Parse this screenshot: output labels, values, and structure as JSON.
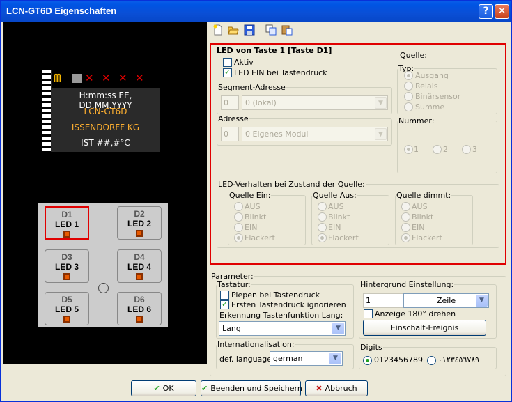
{
  "window": {
    "title": "LCN-GT6D Eigenschaften"
  },
  "toolbar": {
    "icons": [
      "new-icon",
      "open-icon",
      "save-icon",
      "copy-icon",
      "paste-icon"
    ]
  },
  "display": {
    "line1": "H:mm:ss EE, DD.MM.YYYY",
    "line2": "LCN-GT6D",
    "line3": "ISSENDORFF KG",
    "line4": "IST ##,#°C",
    "line_colors": [
      "#ffffff",
      "#ffb030",
      "#ffb030",
      "#ffffff"
    ]
  },
  "keys": [
    {
      "top": "D1",
      "bottom": "LED 1",
      "selected": true
    },
    {
      "top": "D2",
      "bottom": "LED 2",
      "selected": false
    },
    {
      "top": "D3",
      "bottom": "LED 3",
      "selected": false
    },
    {
      "top": "D4",
      "bottom": "LED 4",
      "selected": false
    },
    {
      "top": "D5",
      "bottom": "LED 5",
      "selected": false
    },
    {
      "top": "D6",
      "bottom": "LED 6",
      "selected": false
    }
  ],
  "led": {
    "group_title": "LED von Taste 1 [Taste D1]",
    "aktiv_label": "Aktiv",
    "aktiv_checked": false,
    "led_ein_label": "LED EIN bei Tastendruck",
    "led_ein_checked": true,
    "segment": {
      "legend": "Segment-Adresse",
      "value": "0",
      "option": "0 (lokal)"
    },
    "adresse": {
      "legend": "Adresse",
      "value": "0",
      "option": "0  Eigenes Modul"
    },
    "quelle": {
      "legend": "Quelle:",
      "typ_legend": "Typ:",
      "typ_options": [
        "Ausgang",
        "Relais",
        "Binärsensor",
        "Summe"
      ],
      "nummer_legend": "Nummer:",
      "nummer_options": [
        "1",
        "2",
        "3"
      ]
    },
    "verhalten": {
      "legend": "LED-Verhalten bei Zustand der Quelle:",
      "groups": [
        {
          "legend": "Quelle Ein:",
          "options": [
            "AUS",
            "Blinkt",
            "EIN",
            "Flackert"
          ]
        },
        {
          "legend": "Quelle Aus:",
          "options": [
            "AUS",
            "Blinkt",
            "EIN",
            "Flackert"
          ]
        },
        {
          "legend": "Quelle dimmt:",
          "options": [
            "AUS",
            "Blinkt",
            "EIN",
            "Flackert"
          ]
        }
      ]
    }
  },
  "parameter": {
    "legend": "Parameter:",
    "tastatur": {
      "legend": "Tastatur:",
      "piepen_label": "Piepen bei Tastendruck",
      "piepen_checked": false,
      "ersten_label": "Ersten Tastendruck ignorieren",
      "ersten_checked": true,
      "erkennung_label": "Erkennung Tastenfunktion Lang:",
      "erkennung_value": "Lang"
    },
    "hintergrund": {
      "legend": "Hintergrund Einstellung:",
      "count": "1",
      "unit": "Zeile",
      "anzeige_label": "Anzeige 180° drehen",
      "anzeige_checked": false,
      "event_button": "Einschalt-Ereignis"
    },
    "intl": {
      "legend": "Internationalisation:",
      "lang_label": "def. language",
      "lang_value": "german"
    },
    "digits": {
      "legend": "Digits",
      "option1": "0123456789",
      "option2": "٠١٢٣٤٥٦٧٨٩"
    }
  },
  "buttons": {
    "ok": "OK",
    "save": "Beenden und Speichern",
    "cancel": "Abbruch"
  }
}
